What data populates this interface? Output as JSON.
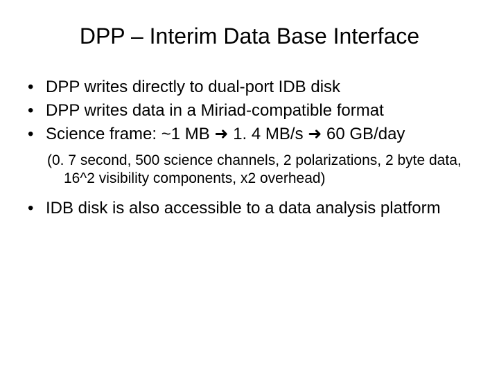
{
  "title": "DPP – Interim Data Base Interface",
  "bullets": {
    "b1": "DPP writes directly to dual-port IDB disk",
    "b2": "DPP writes data in a Miriad-compatible format",
    "b3": "Science frame: ~1 MB ➜ 1. 4 MB/s ➜ 60 GB/day",
    "b4": "IDB disk is also accessible to a data analysis platform"
  },
  "sub": "(0. 7 second, 500 science channels, 2 polarizations, 2 byte data, 16^2 visibility components, x2 overhead)"
}
